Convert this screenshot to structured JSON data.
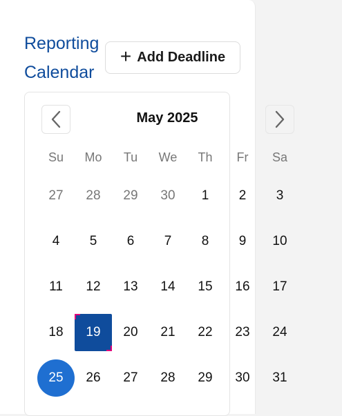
{
  "panel": {
    "title_line1": "Reporting",
    "title_line2": "Calendar",
    "add_button_label": "Add Deadline",
    "add_button_icon": "plus-icon"
  },
  "calendar": {
    "month_label": "May 2025",
    "prev_icon": "chevron-left-icon",
    "next_icon": "chevron-right-icon",
    "weekdays": [
      "Su",
      "Mo",
      "Tu",
      "We",
      "Th",
      "Fr",
      "Sa"
    ],
    "weeks": [
      [
        "27",
        "28",
        "29",
        "30",
        "1",
        "2",
        "3"
      ],
      [
        "4",
        "5",
        "6",
        "7",
        "8",
        "9",
        "10"
      ],
      [
        "11",
        "12",
        "13",
        "14",
        "15",
        "16",
        "17"
      ],
      [
        "18",
        "19",
        "20",
        "21",
        "22",
        "23",
        "24"
      ],
      [
        "25",
        "26",
        "27",
        "28",
        "29",
        "30",
        "31"
      ]
    ],
    "selected_day": "19",
    "today_day": "25",
    "colors": {
      "title": "#0f4c9c",
      "selected_bg": "#0f4c9c",
      "today_bg": "#1f6fd1",
      "focus_corner": "#e0007a"
    }
  }
}
